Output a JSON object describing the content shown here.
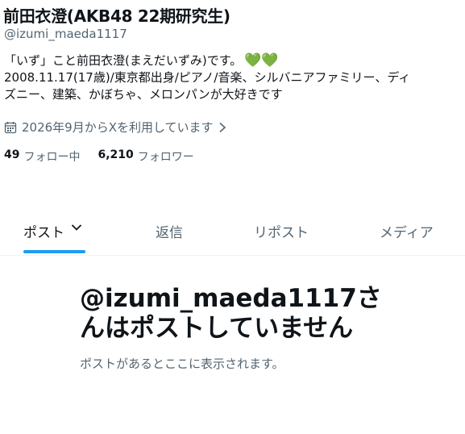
{
  "profile": {
    "display_name": "前田衣澄(AKB48 22期研究生)",
    "handle": "@izumi_maeda1117",
    "bio_lines": [
      "「いず」こと前田衣澄(まえだいずみ)です。",
      "2008.11.17(17歳)/東京都出身/ピアノ/音楽、シルバニアファミリー、ディ",
      "ズニー、建築、かぼちゃ、メロンパンが大好きです"
    ],
    "bio_emoji": "💚💚",
    "joined": "2026年9月からXを利用しています",
    "following_count": "49",
    "following_label": "フォロー中",
    "followers_count": "6,210",
    "followers_label": "フォロワー"
  },
  "tabs": [
    {
      "label": "ポスト",
      "active": true
    },
    {
      "label": "返信",
      "active": false
    },
    {
      "label": "リポスト",
      "active": false
    },
    {
      "label": "メディア",
      "active": false
    }
  ],
  "empty_state": {
    "title": "@izumi_maeda1117さんはポストしていません",
    "subtitle": "ポストがあるとここに表示されます。"
  },
  "colors": {
    "accent": "#1d9bf0",
    "text": "#0f1419",
    "secondary": "#536471",
    "heart": "#5aa84a"
  },
  "icons": [
    "calendar-icon",
    "chevron-right-icon",
    "chevron-down-icon",
    "green-heart-icon"
  ]
}
